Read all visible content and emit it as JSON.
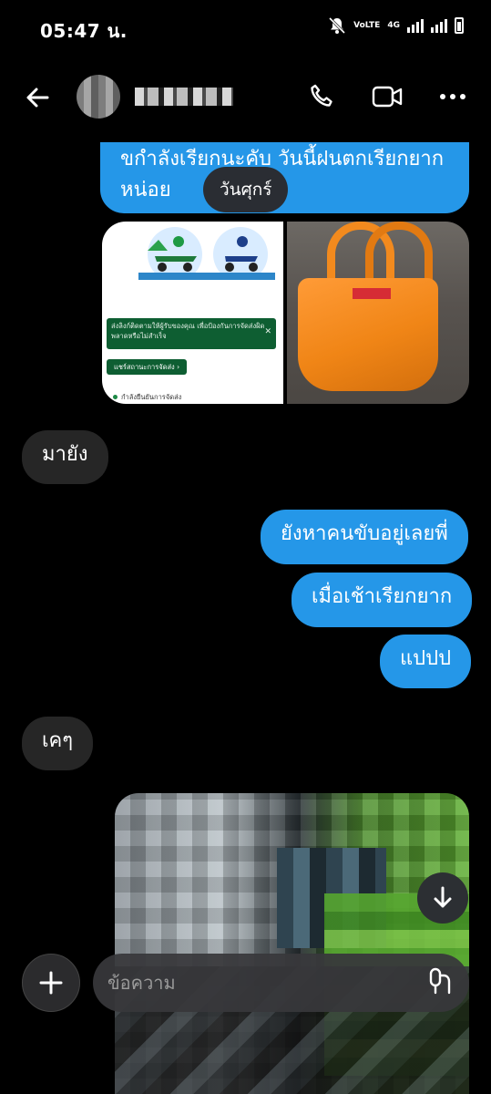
{
  "status_bar": {
    "time": "05:47 น.",
    "network_label": "4G",
    "carrier_label": "VoLTE"
  },
  "header": {
    "contact_name": "T***** **"
  },
  "date_separator": "วันศุกร์",
  "messages": [
    {
      "direction": "outgoing",
      "text": "ขกำลังเรียกนะคับ วันนี้ฝนตกเรียกยาก หน่อย"
    },
    {
      "direction": "incoming",
      "text": "มายัง"
    },
    {
      "direction": "outgoing",
      "text": "ยังหาคนขับอยู่เลยพี่"
    },
    {
      "direction": "outgoing",
      "text": "เมื่อเช้าเรียกยาก"
    },
    {
      "direction": "outgoing",
      "text": "แปปป"
    },
    {
      "direction": "incoming",
      "text": "เคๆ"
    }
  ],
  "shared_screenshot": {
    "banner_text": "ส่งลิงก์ติดตามให้ผู้รับของคุณ เพื่อป้องกันการจัดส่งผิดพลาดหรือไม่สำเร็จ",
    "button_text": "แชร์สถานะการจัดส่ง",
    "status_text": "กำลังยืนยันการจัดส่ง"
  },
  "composer": {
    "placeholder": "ข้อความ"
  },
  "colors": {
    "outgoing_bubble": "#2597e8",
    "incoming_bubble": "#262626",
    "background": "#000000"
  }
}
